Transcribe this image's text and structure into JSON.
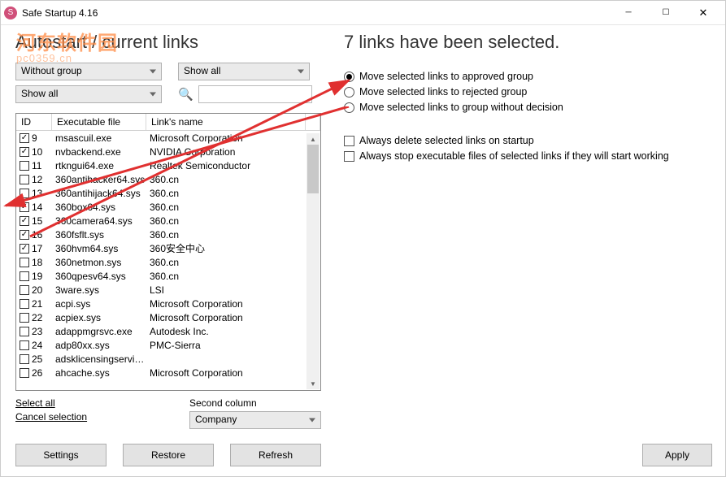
{
  "titlebar": {
    "title": "Safe Startup 4.16"
  },
  "watermark": {
    "text": "河东软件园",
    "sub": "pc0359.cn"
  },
  "left": {
    "heading": "Autostart / current links",
    "filter1": "Without group",
    "filter2": "Show all",
    "filter3": "Show all",
    "search_placeholder": "",
    "headers": {
      "id": "ID",
      "exe": "Executable file",
      "link": "Link's name"
    },
    "rows": [
      {
        "checked": true,
        "id": "9",
        "exe": "msascuil.exe",
        "link": "Microsoft Corporation"
      },
      {
        "checked": true,
        "id": "10",
        "exe": "nvbackend.exe",
        "link": "NVIDIA Corporation"
      },
      {
        "checked": false,
        "id": "11",
        "exe": "rtkngui64.exe",
        "link": "Realtek Semiconductor"
      },
      {
        "checked": false,
        "id": "12",
        "exe": "360antihacker64.sys",
        "link": "360.cn"
      },
      {
        "checked": false,
        "id": "13",
        "exe": "360antihijack64.sys",
        "link": "360.cn"
      },
      {
        "checked": true,
        "id": "14",
        "exe": "360box64.sys",
        "link": "360.cn"
      },
      {
        "checked": true,
        "id": "15",
        "exe": "360camera64.sys",
        "link": "360.cn"
      },
      {
        "checked": true,
        "id": "16",
        "exe": "360fsflt.sys",
        "link": "360.cn"
      },
      {
        "checked": true,
        "id": "17",
        "exe": "360hvm64.sys",
        "link": "360安全中心"
      },
      {
        "checked": false,
        "id": "18",
        "exe": "360netmon.sys",
        "link": "360.cn"
      },
      {
        "checked": false,
        "id": "19",
        "exe": "360qpesv64.sys",
        "link": "360.cn"
      },
      {
        "checked": false,
        "id": "20",
        "exe": "3ware.sys",
        "link": "LSI"
      },
      {
        "checked": false,
        "id": "21",
        "exe": "acpi.sys",
        "link": "Microsoft Corporation"
      },
      {
        "checked": false,
        "id": "22",
        "exe": "acpiex.sys",
        "link": "Microsoft Corporation"
      },
      {
        "checked": false,
        "id": "23",
        "exe": "adappmgrsvc.exe",
        "link": "Autodesk Inc."
      },
      {
        "checked": false,
        "id": "24",
        "exe": "adp80xx.sys",
        "link": "PMC-Sierra"
      },
      {
        "checked": false,
        "id": "25",
        "exe": "adsklicensingservice...",
        "link": ""
      },
      {
        "checked": false,
        "id": "26",
        "exe": "ahcache.sys",
        "link": "Microsoft Corporation"
      }
    ],
    "select_all": "Select all",
    "cancel_selection": "Cancel selection",
    "second_column_label": "Second column",
    "second_column_value": "Company",
    "btn_settings": "Settings",
    "btn_restore": "Restore",
    "btn_refresh": "Refresh"
  },
  "right": {
    "heading": "7 links have been selected.",
    "radio1": "Move selected links to approved group",
    "radio2": "Move selected links to rejected group",
    "radio3": "Move selected links to group without decision",
    "check1": "Always delete selected links on startup",
    "check2": "Always stop executable files of selected links if they will start working",
    "btn_apply": "Apply"
  }
}
